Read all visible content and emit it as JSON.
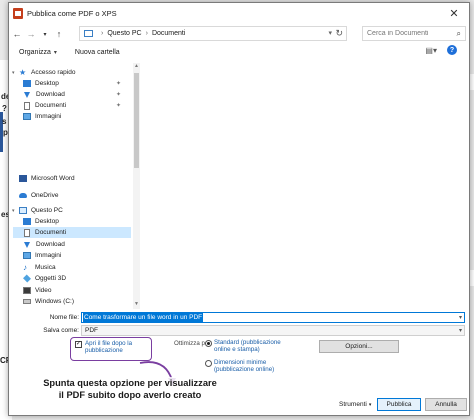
{
  "background": {
    "fragments": [
      "de",
      "?",
      "s",
      "po",
      "es",
      "CPS"
    ]
  },
  "dialog": {
    "title": "Pubblica come PDF o XPS",
    "address": {
      "segments": [
        "Questo PC",
        "Documenti"
      ]
    },
    "search": {
      "placeholder": "Cerca in Documenti"
    },
    "toolbar": {
      "organize": "Organizza",
      "new_folder": "Nuova cartella"
    },
    "nav": {
      "quick_access": "Accesso rapido",
      "quick_items": [
        "Desktop",
        "Download",
        "Documenti",
        "Immagini"
      ],
      "word": "Microsoft Word",
      "onedrive": "OneDrive",
      "this_pc": "Questo PC",
      "pc_items": [
        "Desktop",
        "Documenti",
        "Download",
        "Immagini",
        "Musica",
        "Oggetti 3D",
        "Video",
        "Windows (C:)"
      ]
    },
    "form": {
      "filename_label": "Nome file:",
      "filename_value": "Come trasformare un file word in un PDF",
      "type_label": "Salva come:",
      "type_value": "PDF",
      "open_after_label": "Apri il file dopo la pubblicazione",
      "optimize_label": "Ottimizza per:",
      "radio_standard": "Standard (pubblicazione online e stampa)",
      "radio_minimum": "Dimensioni minime (pubblicazione online)",
      "options_button": "Opzioni..."
    },
    "bottom": {
      "tools": "Strumenti",
      "publish": "Pubblica",
      "cancel": "Annulla"
    }
  },
  "annotation": {
    "line1": "Spunta questa opzione per visualizzare",
    "line2": "il PDF subito dopo averlo creato"
  },
  "colors": {
    "accent": "#0078d7",
    "annotation_outline": "#7a3ea0",
    "selection": "#cce8ff"
  }
}
